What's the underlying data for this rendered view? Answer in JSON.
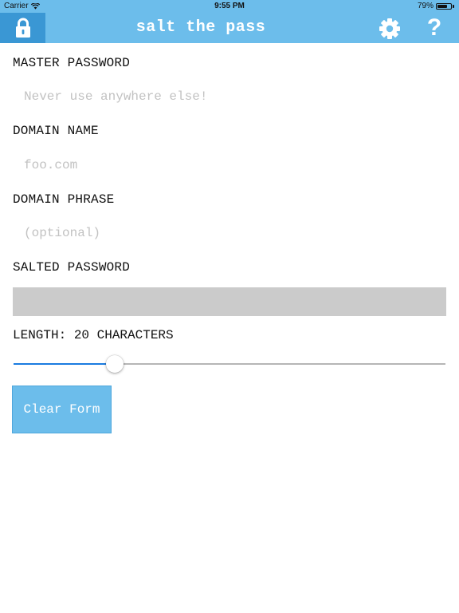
{
  "status_bar": {
    "carrier": "Carrier",
    "time": "9:55 PM",
    "battery": "79%",
    "battery_level": 0.79
  },
  "nav": {
    "title": "salt the pass",
    "help_label": "?",
    "icons": {
      "left": "lock-icon",
      "settings": "gear-icon"
    }
  },
  "form": {
    "master_password": {
      "label": "MASTER PASSWORD",
      "value": "",
      "placeholder": "Never use anywhere else!"
    },
    "domain_name": {
      "label": "DOMAIN NAME",
      "value": "",
      "placeholder": "foo.com"
    },
    "domain_phrase": {
      "label": "DOMAIN PHRASE",
      "value": "",
      "placeholder": "(optional)"
    },
    "salted_password": {
      "label": "SALTED PASSWORD",
      "value": ""
    },
    "length": {
      "label": "LENGTH: 20 CHARACTERS",
      "value": 20,
      "slider_fraction": 0.235
    },
    "clear_label": "Clear Form"
  },
  "colors": {
    "bar": "#6cbdeb",
    "lock_bg": "#3a97d4",
    "slider_fill": "#1a7be0",
    "salted_bg": "#cbcbcb",
    "placeholder": "#c2c2c2"
  }
}
